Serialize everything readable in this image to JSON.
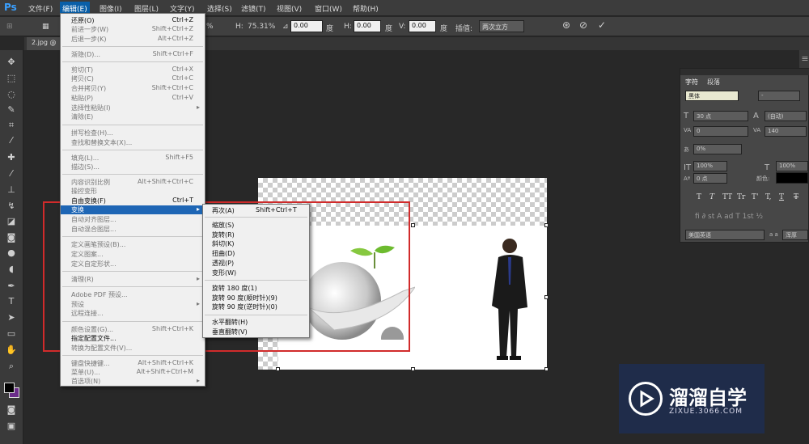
{
  "app": {
    "logo": "Ps"
  },
  "menubar": [
    "文件(F)",
    "编辑(E)",
    "图像(I)",
    "图层(L)",
    "文字(Y)",
    "选择(S)",
    "滤镜(T)",
    "视图(V)",
    "窗口(W)",
    "帮助(H)"
  ],
  "options": {
    "w_value": "%",
    "h_label": "H:",
    "h_value": "75.31%",
    "angle_value": "0.00",
    "angle_unit": "度",
    "hskew_label": "H:",
    "hskew_value": "0.00",
    "hskew_unit": "度",
    "vskew_label": "V:",
    "vskew_value": "0.00",
    "vskew_unit": "度",
    "interp_label": "插值:",
    "interp_value": "两次立方"
  },
  "doc_tab": "2.jpg @",
  "edit_menu": [
    {
      "label": "还原(O)",
      "shortcut": "Ctrl+Z",
      "enabled": true
    },
    {
      "label": "前进一步(W)",
      "shortcut": "Shift+Ctrl+Z",
      "enabled": false
    },
    {
      "label": "后退一步(K)",
      "shortcut": "Alt+Ctrl+Z",
      "enabled": false
    },
    {
      "label": "渐隐(D)...",
      "shortcut": "Shift+Ctrl+F",
      "enabled": false
    },
    {
      "label": "剪切(T)",
      "shortcut": "Ctrl+X",
      "enabled": false
    },
    {
      "label": "拷贝(C)",
      "shortcut": "Ctrl+C",
      "enabled": false
    },
    {
      "label": "合并拷贝(Y)",
      "shortcut": "Shift+Ctrl+C",
      "enabled": false
    },
    {
      "label": "粘贴(P)",
      "shortcut": "Ctrl+V",
      "enabled": false
    },
    {
      "label": "选择性粘贴(I)",
      "shortcut": "",
      "enabled": false
    },
    {
      "label": "清除(E)",
      "shortcut": "",
      "enabled": false
    },
    {
      "label": "拼写检查(H)...",
      "shortcut": "",
      "enabled": false
    },
    {
      "label": "查找和替换文本(X)...",
      "shortcut": "",
      "enabled": false
    },
    {
      "label": "填充(L)...",
      "shortcut": "Shift+F5",
      "enabled": false
    },
    {
      "label": "描边(S)...",
      "shortcut": "",
      "enabled": false
    },
    {
      "label": "内容识别比例",
      "shortcut": "Alt+Shift+Ctrl+C",
      "enabled": false
    },
    {
      "label": "操控变形",
      "shortcut": "",
      "enabled": false
    },
    {
      "label": "自由变换(F)",
      "shortcut": "Ctrl+T",
      "enabled": true
    },
    {
      "label": "变换",
      "shortcut": "",
      "enabled": true
    },
    {
      "label": "自动对齐图层...",
      "shortcut": "",
      "enabled": false
    },
    {
      "label": "自动混合图层...",
      "shortcut": "",
      "enabled": false
    },
    {
      "label": "定义画笔预设(B)...",
      "shortcut": "",
      "enabled": false
    },
    {
      "label": "定义图案...",
      "shortcut": "",
      "enabled": false
    },
    {
      "label": "定义自定形状...",
      "shortcut": "",
      "enabled": false
    },
    {
      "label": "清理(R)",
      "shortcut": "",
      "enabled": false
    },
    {
      "label": "Adobe PDF 预设...",
      "shortcut": "",
      "enabled": false
    },
    {
      "label": "预设",
      "shortcut": "",
      "enabled": false
    },
    {
      "label": "远程连接...",
      "shortcut": "",
      "enabled": false
    },
    {
      "label": "颜色设置(G)...",
      "shortcut": "Shift+Ctrl+K",
      "enabled": false
    },
    {
      "label": "指定配置文件...",
      "shortcut": "",
      "enabled": true
    },
    {
      "label": "转换为配置文件(V)...",
      "shortcut": "",
      "enabled": false
    },
    {
      "label": "键盘快捷键...",
      "shortcut": "Alt+Shift+Ctrl+K",
      "enabled": false
    },
    {
      "label": "菜单(U)...",
      "shortcut": "Alt+Shift+Ctrl+M",
      "enabled": false
    },
    {
      "label": "首选项(N)",
      "shortcut": "",
      "enabled": false
    }
  ],
  "transform_menu": [
    {
      "label": "再次(A)",
      "shortcut": "Shift+Ctrl+T"
    },
    {
      "label": "缩放(S)",
      "shortcut": ""
    },
    {
      "label": "旋转(R)",
      "shortcut": ""
    },
    {
      "label": "斜切(K)",
      "shortcut": ""
    },
    {
      "label": "扭曲(D)",
      "shortcut": ""
    },
    {
      "label": "透视(P)",
      "shortcut": ""
    },
    {
      "label": "变形(W)",
      "shortcut": ""
    },
    {
      "label": "旋转 180 度(1)",
      "shortcut": ""
    },
    {
      "label": "旋转 90 度(顺时针)(9)",
      "shortcut": ""
    },
    {
      "label": "旋转 90 度(逆时针)(0)",
      "shortcut": ""
    },
    {
      "label": "水平翻转(H)",
      "shortcut": ""
    },
    {
      "label": "垂直翻转(V)",
      "shortcut": ""
    }
  ],
  "char_panel": {
    "tabs": [
      "字符",
      "段落"
    ],
    "font_family": "黑体",
    "font_style": "-",
    "size": "30 点",
    "leading": "(自动)",
    "kerning": "0",
    "tracking": "140",
    "scale_pct": "0%",
    "v_scale": "100%",
    "h_scale": "100%",
    "baseline": "0 点",
    "color_label": "颜色:",
    "type_buttons": [
      "T",
      "T",
      "TT",
      "Tr",
      "T'",
      "T,",
      "T",
      "T"
    ],
    "language": "美国英语",
    "aa_label": "a a",
    "aa_value": "浑厚"
  },
  "watermark": {
    "title": "溜溜自学",
    "subtitle": "ZIXUE.3066.COM"
  },
  "colors": {
    "menu_highlight": "#1e66b5",
    "red_box": "#d12b2b",
    "fg": "#000000",
    "bg": "#6b2c8a"
  }
}
